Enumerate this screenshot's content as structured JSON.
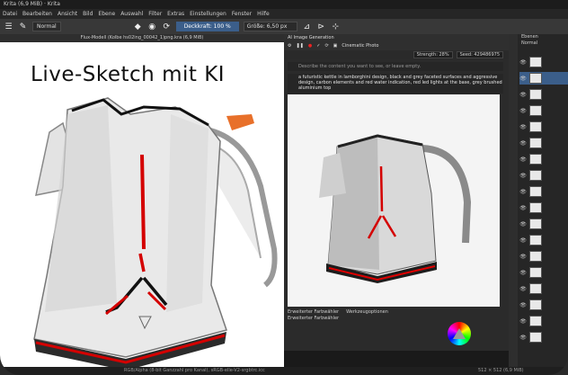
{
  "window": {
    "title": "Krita (6,9 MiB) · Krita"
  },
  "menu": [
    "Datei",
    "Bearbeiten",
    "Ansicht",
    "Bild",
    "Ebene",
    "Auswahl",
    "Filter",
    "Extras",
    "Einstellungen",
    "Fenster",
    "Hilfe"
  ],
  "toolbar": {
    "blend_mode": "Normal",
    "opacity_label": "Deckkraft: 100 %",
    "size_label": "Größe: 6,50 px"
  },
  "canvas": {
    "doc_tab": "Flux-Modell (Kolbe hs02ing_00042_1)png.kra (6,9 MiB)",
    "title": "Live-Sketch mit KI"
  },
  "ai_panel": {
    "header": "AI Image Generation",
    "style_label": "Cinematic Photo",
    "strength_label": "Strength: 28%",
    "seed_label": "Seed: 429486975",
    "negative_placeholder": "Describe the content you want to see, or leave empty.",
    "prompt": "a futuristic kettle in lamborghini design, black and grey faceted surfaces and aggressive design, carbon elements and red water indication, red led lights at the base, grey brushed aluminium top",
    "bottom_tabs": [
      "Erweiterter Farbwähler",
      "Werkzeugoptionen"
    ],
    "bottom_label": "Erweiterter Farbwähler"
  },
  "layers": {
    "header": "Ebenen",
    "mode": "Normal",
    "count": 18
  },
  "status": {
    "left": "RGB/Alpha (8-bit Ganzzahl pro Kanal), sRGB-elle-V2-srgbtrc.icc",
    "right": "512 × 512 (6,9 MiB)"
  }
}
